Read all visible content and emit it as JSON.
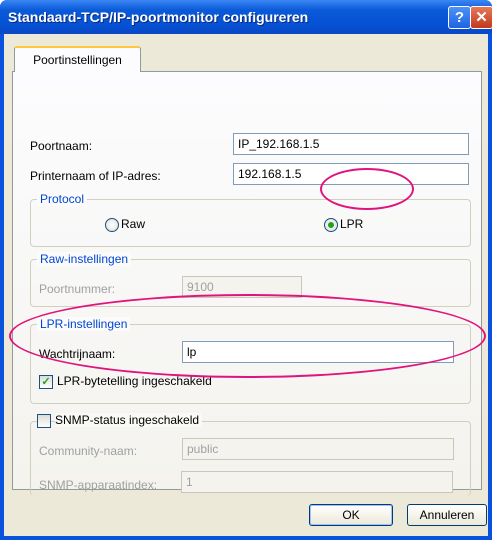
{
  "window": {
    "title": "Standaard-TCP/IP-poortmonitor configureren",
    "help": "?",
    "close": "✕"
  },
  "tab": {
    "label": "Poortinstellingen"
  },
  "port_name": {
    "label": "Poortnaam:",
    "value": "IP_192.168.1.5"
  },
  "printer_address": {
    "label": "Printernaam of IP-adres:",
    "value": "192.168.1.5"
  },
  "protocol": {
    "group_label": "Protocol",
    "raw_label": "Raw",
    "lpr_label": "LPR",
    "selected": "LPR"
  },
  "raw_settings": {
    "group_label": "Raw-instellingen",
    "port_number_label": "Poortnummer:",
    "port_number_value": "9100"
  },
  "lpr_settings": {
    "group_label": "LPR-instellingen",
    "queue_label": "Wachtrijnaam:",
    "queue_value": "lp",
    "byte_count_label": "LPR-bytetelling ingeschakeld",
    "byte_count_checked": true
  },
  "snmp": {
    "checkbox_label": "SNMP-status ingeschakeld",
    "checked": false,
    "community_label": "Community-naam:",
    "community_value": "public",
    "device_index_label": "SNMP-apparaatindex:",
    "device_index_value": "1"
  },
  "buttons": {
    "ok": "OK",
    "cancel": "Annuleren"
  },
  "colors": {
    "titlebar": "#0552d6",
    "highlight": "#e0147c",
    "group_label": "#0046d5"
  }
}
